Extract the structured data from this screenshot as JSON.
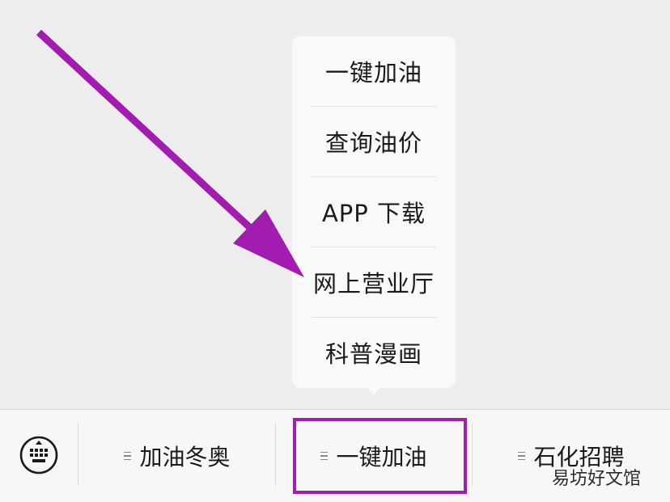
{
  "popup_menu": {
    "items": [
      {
        "label": "一键加油"
      },
      {
        "label": "查询油价"
      },
      {
        "label": "APP 下载"
      },
      {
        "label": "网上营业厅"
      },
      {
        "label": "科普漫画"
      }
    ]
  },
  "bottom_bar": {
    "keyboard_icon": "keyboard-icon",
    "tabs": [
      {
        "label": "加油冬奥"
      },
      {
        "label": "一键加油"
      },
      {
        "label": "石化招聘"
      }
    ]
  },
  "annotation": {
    "color": "#a21caf"
  },
  "watermark": {
    "text": "易坊好文馆"
  }
}
